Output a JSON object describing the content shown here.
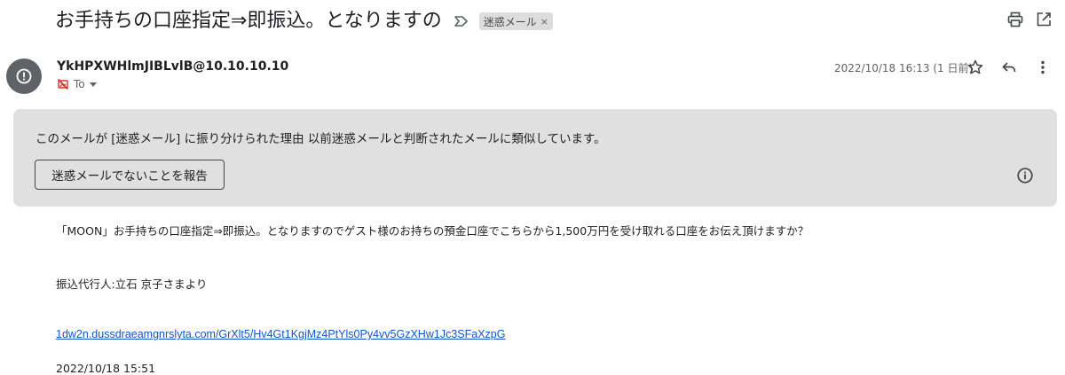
{
  "subject": "お手持ちの口座指定⇒即振込。となりますの",
  "label_chip": {
    "text": "迷惑メール",
    "close": "×"
  },
  "sender": "YkHPXWHlmJIBLvlB@10.10.10.10",
  "to_label": "To",
  "date": "2022/10/18 16:13 (1 日前)",
  "spam_warning": {
    "reason": "このメールが [迷惑メール] に振り分けられた理由 以前迷惑メールと判断されたメールに類似しています。",
    "report_button": "迷惑メールでないことを報告"
  },
  "body": {
    "line1": "「MOON」お手持ちの口座指定⇒即振込。となりますのでゲスト様のお持ちの預金口座でこちらから1,500万円を受け取れる口座をお伝え頂けますか？",
    "line2": "振込代行人:立石 京子さまより",
    "link": "1dw2n.dussdraeamgnrslyta.com/GrXlt5/Hv4Gt1KgjMz4PtYls0Py4vv5GzXHw1Jc3SFaXzpG",
    "line3": "2022/10/18 15:51"
  },
  "icons": {
    "importance": "label-important-icon",
    "print": "print-icon",
    "open_new_window": "open-in-new-icon",
    "avatar": "alert-circle-icon",
    "unsafe_recipient": "image-off-icon",
    "star": "star-icon",
    "reply": "reply-icon",
    "more": "more-vert-icon",
    "info": "info-icon"
  },
  "colors": {
    "avatar_bg": "#5f6368",
    "spam_box_bg": "#e0e0e0",
    "link": "#1155cc",
    "chip_bg": "#dddddd",
    "unsafe_icon": "#d93025"
  }
}
